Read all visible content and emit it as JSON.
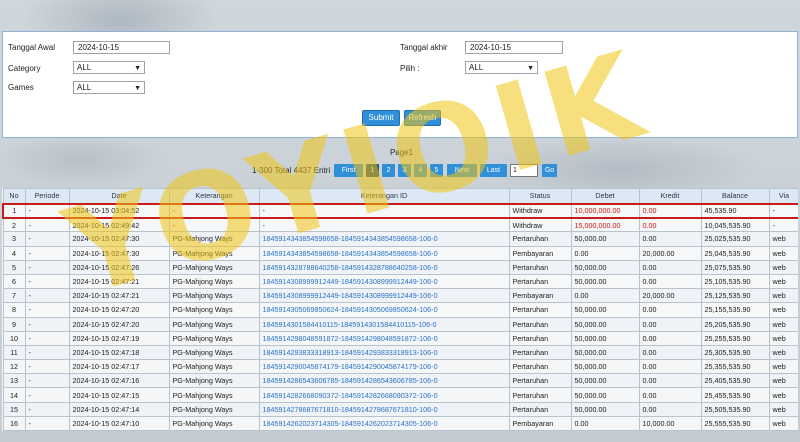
{
  "filters": {
    "tanggal_awal_label": "Tanggal Awal",
    "tanggal_awal_value": "2024-10-15",
    "tanggal_akhir_label": "Tanggal akhir",
    "tanggal_akhir_value": "2024-10-15",
    "category_label": "Category",
    "category_value": "ALL",
    "pilih_label": "Pilih  :",
    "pilih_value": "ALL",
    "games_label": "Games",
    "games_value": "ALL",
    "submit_label": "Submit",
    "refresh_label": "Refresh"
  },
  "pager": {
    "title": "Page1",
    "info": "1-300 Total 4437 Entri",
    "first": "First",
    "pages": [
      "1",
      "2",
      "3",
      "4",
      "5"
    ],
    "next": "Next",
    "last": "Last",
    "input_value": "1",
    "go": "Go"
  },
  "watermark": "YOYIOIK",
  "table": {
    "columns": [
      "No",
      "Periode",
      "Date",
      "Keterangan",
      "Keterangan ID",
      "Status",
      "Debet",
      "Kredit",
      "Balance",
      "Via"
    ],
    "rows": [
      [
        "1",
        "-",
        "2024-10-15 03:04:52",
        "-",
        "-",
        "Withdraw",
        "10,000,000.00",
        "0.00",
        "45,535.90",
        "-"
      ],
      [
        "2",
        "-",
        "2024-10-15 02:49:42",
        "-",
        "-",
        "Withdraw",
        "15,000,000.00",
        "0.00",
        "10,045,535.90",
        "-"
      ],
      [
        "3",
        "-",
        "2024-10-15 02:47:30",
        "PG-Mahjong Ways",
        "1845914343854598658-1845914343854598658-106-0",
        "Pertaruhan",
        "50,000.00",
        "0.00",
        "25,025,535.90",
        "web"
      ],
      [
        "4",
        "-",
        "2024-10-15 02:47:30",
        "PG-Mahjong Ways",
        "1845914343854598658-1845914343854598658-106-0",
        "Pembayaran",
        "0.00",
        "20,000.00",
        "25,045,535.90",
        "web"
      ],
      [
        "5",
        "-",
        "2024-10-15 02:47:26",
        "PG-Mahjong Ways",
        "1845914328788640258-1845914328788640258-106-0",
        "Pertaruhan",
        "50,000.00",
        "0.00",
        "25,075,535.90",
        "web"
      ],
      [
        "6",
        "-",
        "2024-10-15 02:47:21",
        "PG-Mahjong Ways",
        "1845914308999912449-1845914308999912449-106-0",
        "Pertaruhan",
        "50,000.00",
        "0.00",
        "25,105,535.90",
        "web"
      ],
      [
        "7",
        "-",
        "2024-10-15 02:47:21",
        "PG-Mahjong Ways",
        "1845914308999912449-1845914308999912449-106-0",
        "Pembayaran",
        "0.00",
        "20,000.00",
        "25,125,535.90",
        "web"
      ],
      [
        "8",
        "-",
        "2024-10-15 02:47:20",
        "PG-Mahjong Ways",
        "1845914305069850624-1845914305069850624-106-0",
        "Pertaruhan",
        "50,000.00",
        "0.00",
        "25,155,535.90",
        "web"
      ],
      [
        "9",
        "-",
        "2024-10-15 02:47:20",
        "PG-Mahjong Ways",
        "1845914301584410115-1845914301584410115-106-0",
        "Pertaruhan",
        "50,000.00",
        "0.00",
        "25,205,535.90",
        "web"
      ],
      [
        "10",
        "-",
        "2024-10-15 02:47:19",
        "PG-Mahjong Ways",
        "1845914298048591872-1845914298048591872-106-0",
        "Pertaruhan",
        "50,000.00",
        "0.00",
        "25,255,535.90",
        "web"
      ],
      [
        "11",
        "-",
        "2024-10-15 02:47:18",
        "PG-Mahjong Ways",
        "1845914293833318913-1845914293833318913-106-0",
        "Pertaruhan",
        "50,000.00",
        "0.00",
        "25,305,535.90",
        "web"
      ],
      [
        "12",
        "-",
        "2024-10-15 02:47:17",
        "PG-Mahjong Ways",
        "1845914290045874179-1845914290045874179-106-0",
        "Pertaruhan",
        "50,000.00",
        "0.00",
        "25,355,535.90",
        "web"
      ],
      [
        "13",
        "-",
        "2024-10-15 02:47:16",
        "PG-Mahjong Ways",
        "1845914286543606785-1845914286543606785-106-0",
        "Pertaruhan",
        "50,000.00",
        "0.00",
        "25,405,535.90",
        "web"
      ],
      [
        "14",
        "-",
        "2024-10-15 02:47:15",
        "PG-Mahjong Ways",
        "1845914282668090372-1845914282668090372-106-0",
        "Pertaruhan",
        "50,000.00",
        "0.00",
        "25,455,535.90",
        "web"
      ],
      [
        "15",
        "-",
        "2024-10-15 02:47:14",
        "PG-Mahjong Ways",
        "1845914278687671810-1845914278687671810-106-0",
        "Pertaruhan",
        "50,000.00",
        "0.00",
        "25,505,535.90",
        "web"
      ],
      [
        "16",
        "-",
        "2024-10-15 02:47:10",
        "PG-Mahjong Ways",
        "1845914262023714305-1845914262023714305-106-0",
        "Pembayaran",
        "0.00",
        "10,000.00",
        "25,555,535.90",
        "web"
      ]
    ]
  }
}
